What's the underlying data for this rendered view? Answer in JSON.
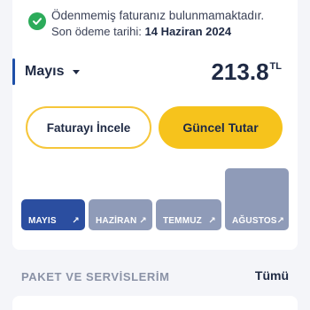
{
  "notice": {
    "line1": "Ödenmemiş faturanız bulunmamaktadır.",
    "line2_prefix": "Son ödeme tarihi:",
    "line2_date": "14 Haziran 2024"
  },
  "invoice": {
    "month": "Mayıs",
    "amount": "213.8",
    "currency": "TL"
  },
  "buttons": {
    "view_invoice": "Faturayı İncele",
    "current_amount": "Güncel Tutar"
  },
  "months": [
    {
      "label": "MAYIS",
      "arrow": "↗"
    },
    {
      "label": "HAZİRAN",
      "arrow": "↗"
    },
    {
      "label": "TEMMUZ",
      "arrow": "↗"
    },
    {
      "label": "AĞUSTOS",
      "arrow": "↗"
    }
  ],
  "packages": {
    "title": "PAKET VE SERVİSLERİM",
    "see_all": "Tümü"
  },
  "colors": {
    "accent_yellow": "#f6c31c",
    "active_bar": "#2b4ea0",
    "inactive_bar": "#8f9bb8",
    "success": "#2cab5a"
  }
}
